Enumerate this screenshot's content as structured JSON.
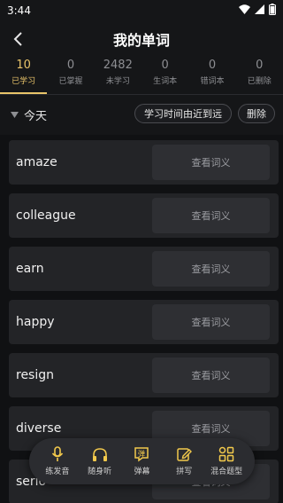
{
  "status": {
    "time": "3:44"
  },
  "header": {
    "title": "我的单词"
  },
  "stats": [
    {
      "count": "10",
      "label": "已学习"
    },
    {
      "count": "0",
      "label": "已掌握"
    },
    {
      "count": "2482",
      "label": "未学习"
    },
    {
      "count": "0",
      "label": "生词本"
    },
    {
      "count": "0",
      "label": "错词本"
    },
    {
      "count": "0",
      "label": "已删除"
    }
  ],
  "toolbar": {
    "group_label": "今天",
    "sort_label": "学习时间由近到远",
    "delete_label": "删除"
  },
  "words": [
    {
      "word": "amaze",
      "action": "查看词义"
    },
    {
      "word": "colleague",
      "action": "查看词义"
    },
    {
      "word": "earn",
      "action": "查看词义"
    },
    {
      "word": "happy",
      "action": "查看词义"
    },
    {
      "word": "resign",
      "action": "查看词义"
    },
    {
      "word": "diverse",
      "action": "查看词义"
    },
    {
      "word": "serio",
      "action": "查看词义"
    }
  ],
  "bottom_bar": [
    {
      "label": "练发音",
      "icon": "microphone-icon"
    },
    {
      "label": "随身听",
      "icon": "headphones-icon"
    },
    {
      "label": "弹幕",
      "icon": "bullet-comment-icon",
      "badge": "弹"
    },
    {
      "label": "拼写",
      "icon": "edit-icon"
    },
    {
      "label": "混合题型",
      "icon": "grid-icon"
    }
  ],
  "colors": {
    "accent": "#e9c46a",
    "icon_yellow": "#f2c94c",
    "background": "#151618"
  }
}
